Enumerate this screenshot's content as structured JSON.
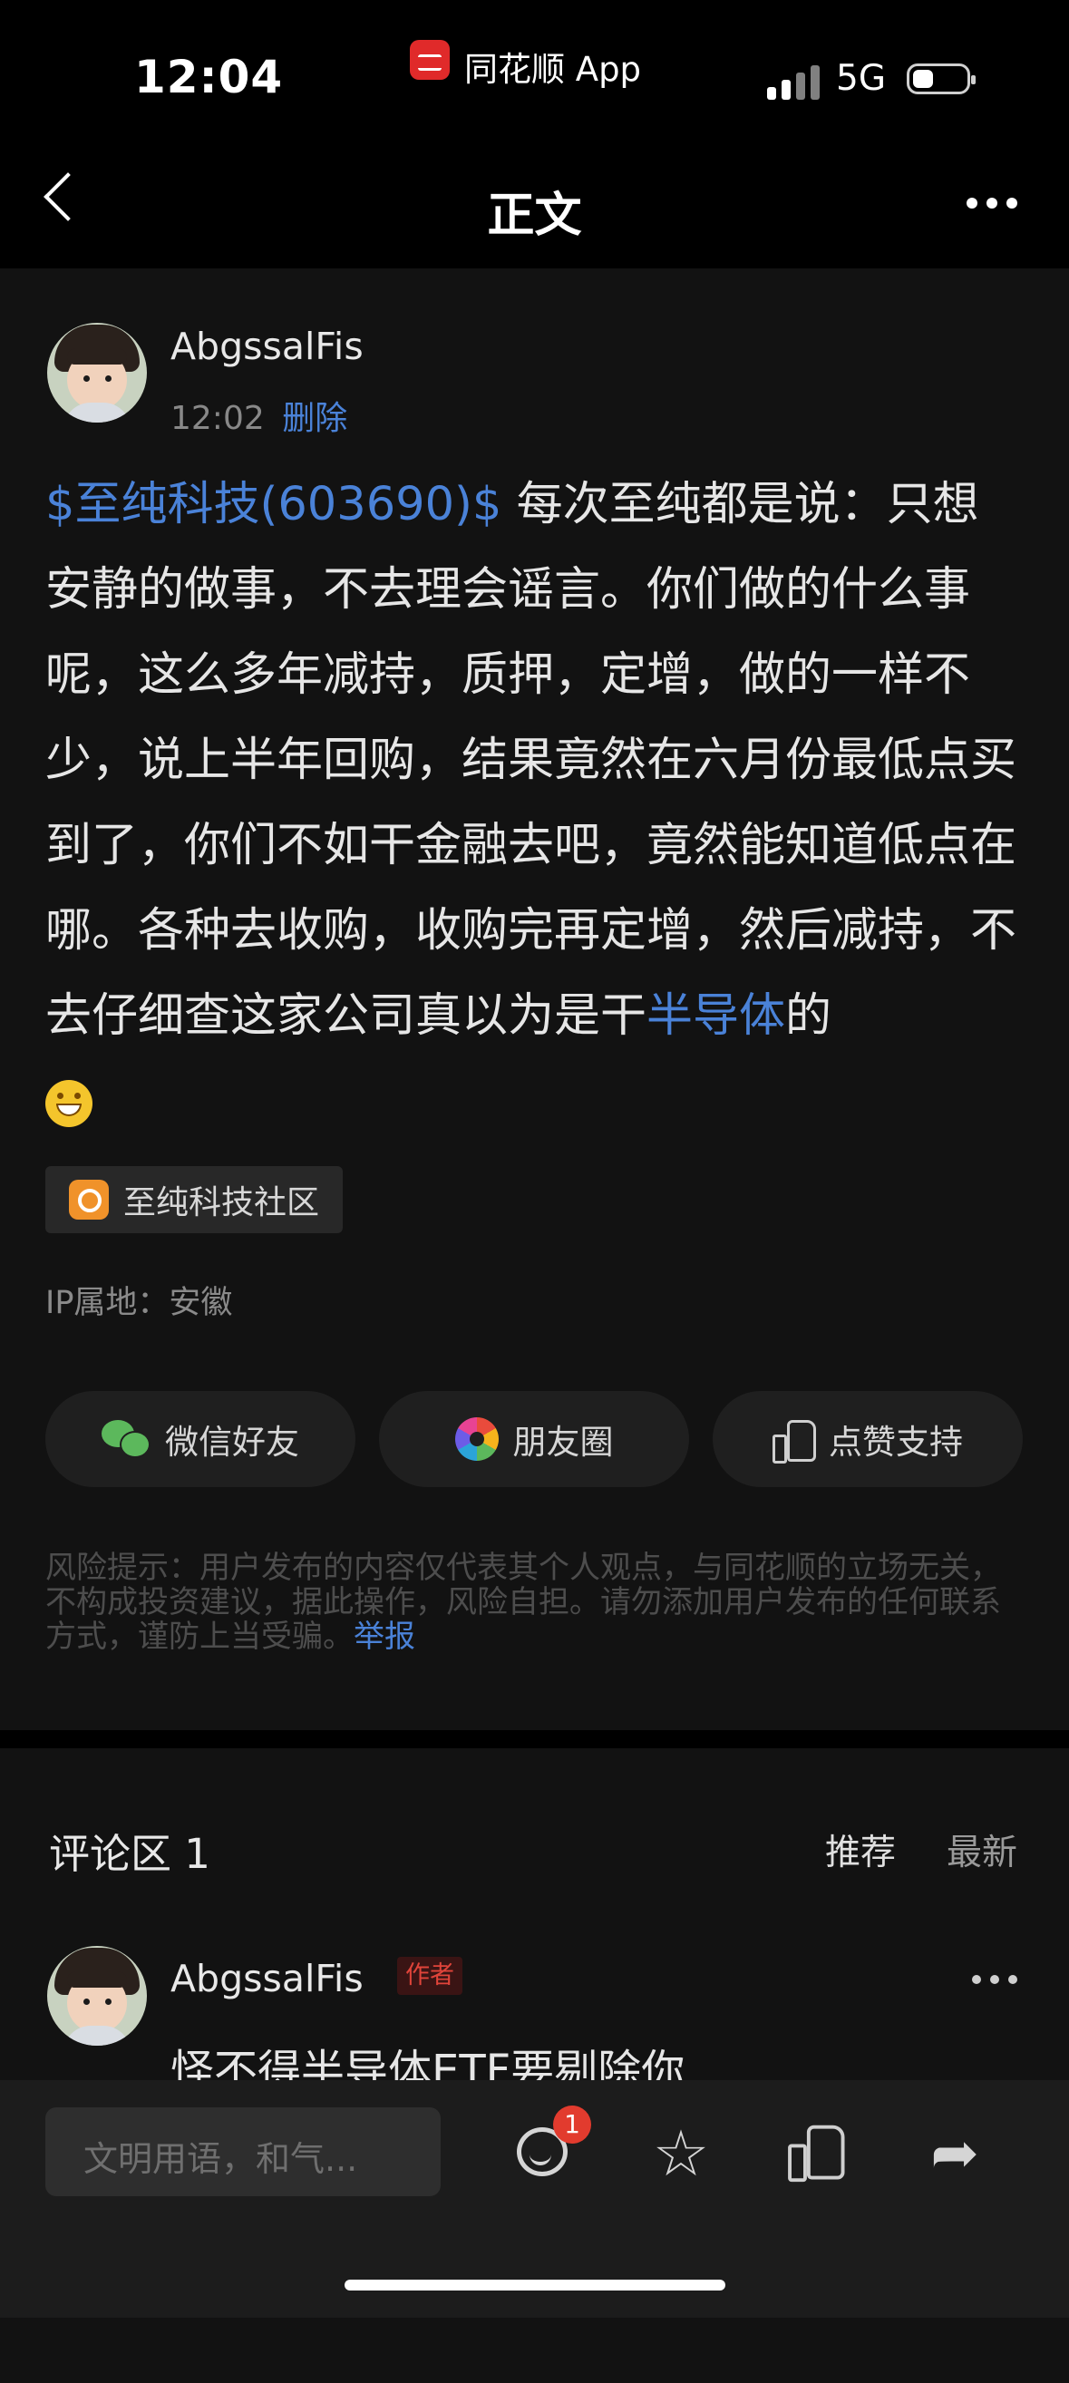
{
  "status_bar": {
    "time": "12:04",
    "app_label": "同花顺 App",
    "network": "5G"
  },
  "nav": {
    "title": "正文"
  },
  "post": {
    "author": "AbgssalFis",
    "time": "12:02",
    "delete_label": "删除",
    "stock_link": "$至纯科技(603690)$",
    "text_part1": " 每次至纯都是说：只想安静的做事，不去理会谣言。你们做的什么事呢，这么多年减持，质押，定增，做的一样不少，说上半年回购，结果竟然在六月份最低点买到了，你们不如干金融去吧，竟然能知道低点在哪。各种去收购，收购完再定增，然后减持，不去仔细查这家公司真以为是干",
    "topic_link": "半导体",
    "text_part2": "的",
    "emoji": "grin-emoji",
    "community_tag": "至纯科技社区",
    "ip_location": "IP属地：安徽"
  },
  "share": {
    "wechat_label": "微信好友",
    "moments_label": "朋友圈",
    "like_label": "点赞支持"
  },
  "risk": {
    "text": "风险提示：用户发布的内容仅代表其个人观点，与同花顺的立场无关，不构成投资建议，据此操作，风险自担。请勿添加用户发布的任何联系方式，谨防上当受骗。",
    "report_label": "举报"
  },
  "comments": {
    "title": "评论区 1",
    "sort_recommend": "推荐",
    "sort_latest": "最新",
    "items": [
      {
        "author": "AbgssalFis",
        "badge": "作者",
        "text": "怪不得半导体ETF要剔除你"
      }
    ]
  },
  "bottom_bar": {
    "input_placeholder": "文明用语，和气...",
    "comment_count": "1"
  },
  "colors": {
    "link": "#4a82d8",
    "author_badge": "#e0443a",
    "notify_badge": "#e23b2e"
  }
}
